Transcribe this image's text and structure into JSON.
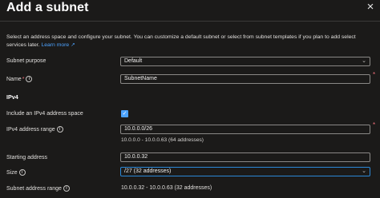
{
  "header": {
    "title": "Add a subnet",
    "close_glyph": "×"
  },
  "description": {
    "text": "Select an address space and configure your subnet. You can customize a default subnet or select from subnet templates if you plan to add select services later.",
    "link": "Learn more"
  },
  "form": {
    "subnet_purpose": {
      "label": "Subnet purpose",
      "value": "Default"
    },
    "name": {
      "label": "Name",
      "required_mark": "*",
      "value": "SubnetName"
    },
    "ipv4_section": "IPv4",
    "include_ipv4": {
      "label": "Include an IPv4 address space",
      "checked": true
    },
    "ipv4_range": {
      "label": "IPv4 address range",
      "value": "10.0.0.0/26",
      "hint": "10.0.0.0 - 10.0.0.63 (64 addresses)"
    },
    "starting_address": {
      "label": "Starting address",
      "value": "10.0.0.32"
    },
    "size": {
      "label": "Size",
      "value": "/27 (32 addresses)"
    },
    "subnet_address_range": {
      "label": "Subnet address range",
      "value": "10.0.0.32 - 10.0.0.63 (32 addresses)"
    }
  },
  "icons": {
    "info": "info-icon",
    "external": "external-link-icon",
    "chevron": "chevron-down-icon",
    "check": "checkmark-icon"
  },
  "colors": {
    "background": "#1b1a19",
    "link": "#4da3ff",
    "accent": "#2b88d8",
    "required": "#f1707b"
  }
}
